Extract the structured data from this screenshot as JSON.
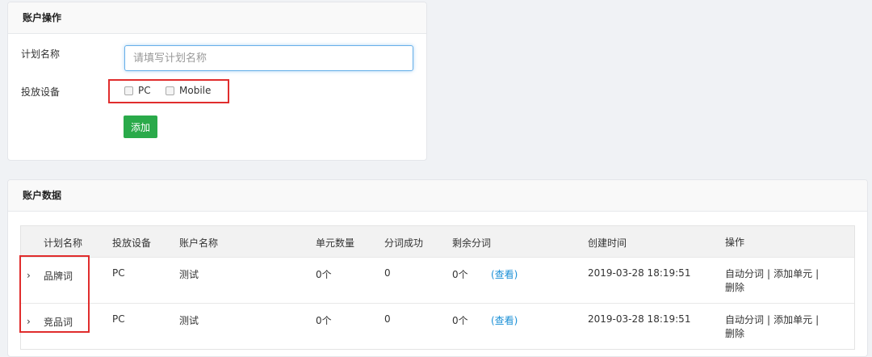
{
  "ops_panel": {
    "title": "账户操作",
    "plan_name_label": "计划名称",
    "plan_name_placeholder": "请填写计划名称",
    "device_label": "投放设备",
    "devices": [
      "PC",
      "Mobile"
    ],
    "add_button": "添加"
  },
  "data_panel": {
    "title": "账户数据",
    "columns": [
      "计划名称",
      "投放设备",
      "账户名称",
      "单元数量",
      "分词成功",
      "剩余分词",
      "创建时间",
      "操作"
    ],
    "rows": [
      {
        "expander": "›",
        "name": "品牌词",
        "device": "PC",
        "account": "测试",
        "units": "0个",
        "success": "0",
        "remain": "0个",
        "view": "(查看)",
        "created": "2019-03-28 18:19:51",
        "ops": [
          "自动分词",
          "添加单元",
          "删除"
        ],
        "sep": "|"
      },
      {
        "expander": "›",
        "name": "竞品词",
        "device": "PC",
        "account": "测试",
        "units": "0个",
        "success": "0",
        "remain": "0个",
        "view": "(查看)",
        "created": "2019-03-28 18:19:51",
        "ops": [
          "自动分词",
          "添加单元",
          "删除"
        ],
        "sep": "|"
      }
    ]
  }
}
